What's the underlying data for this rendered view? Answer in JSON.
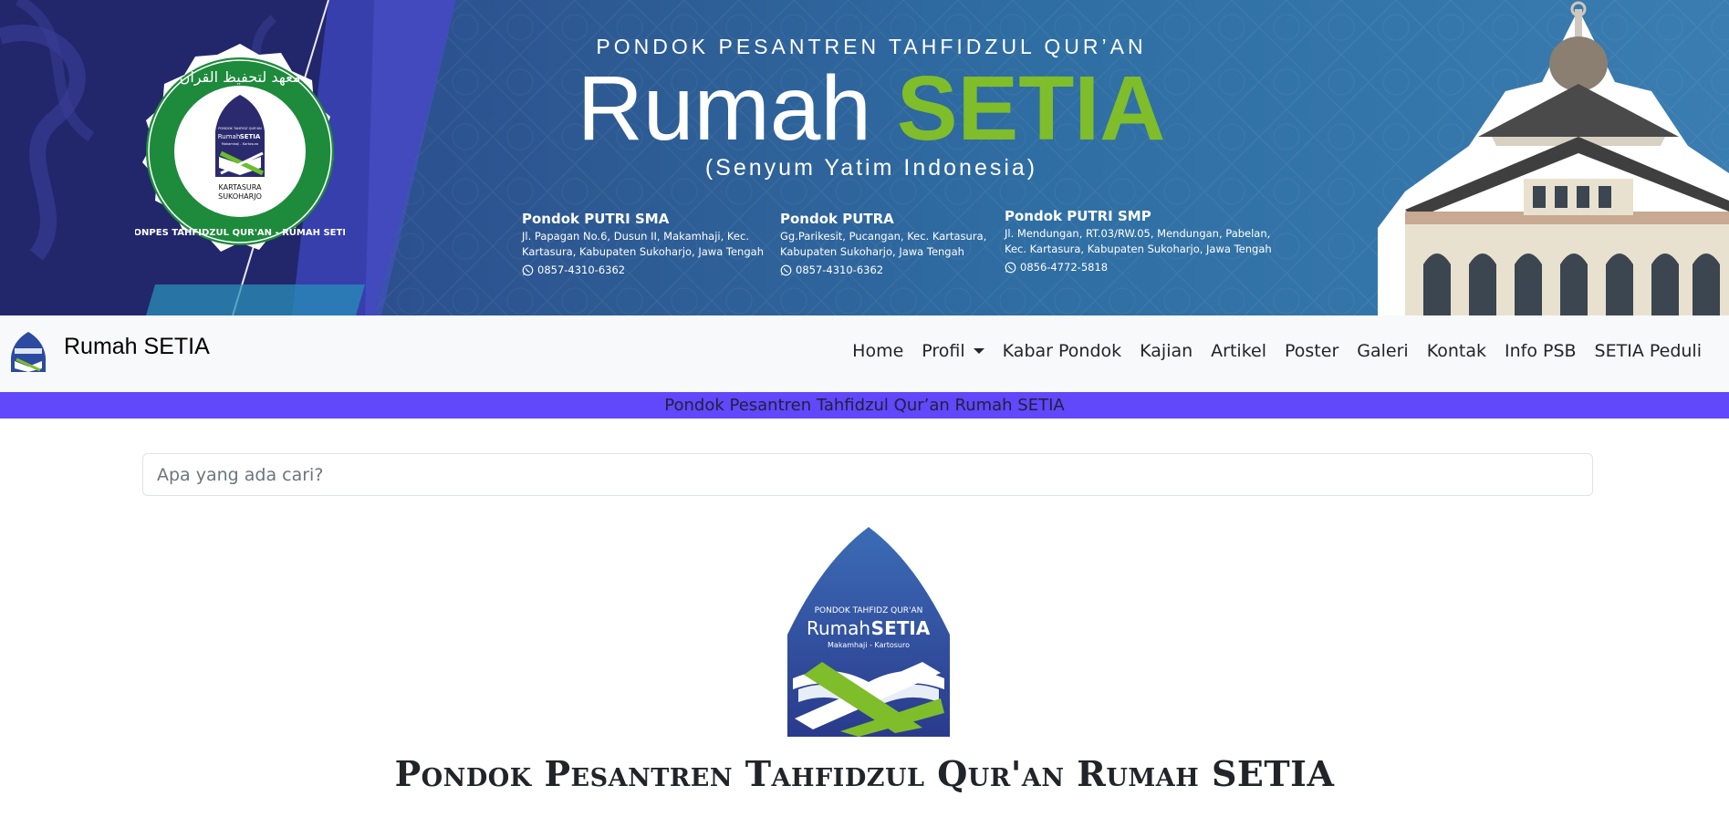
{
  "banner": {
    "kicker": "PONDOK PESANTREN TAHFIDZUL QUR’AN",
    "title_main": "Rumah",
    "title_accent": "SETIA",
    "tagline": "(Senyum Yatim Indonesia)",
    "seal": {
      "arabic": "معهد لتحفيظ القرآن",
      "ring_text": "PONPES TAHFIDZUL QUR'AN - RUMAH SETIA",
      "location_1": "KARTASURA",
      "location_2": "SUKOHARJO",
      "inner_small": "PONDOK TAHFIDZ QUR'AN",
      "inner_brand_1": "Rumah",
      "inner_brand_2": "SETIA",
      "inner_sub": "Makamhaji - Kartosuro"
    },
    "addresses": [
      {
        "name": "Pondok PUTRI SMA",
        "line1": "Jl. Papagan No.6, Dusun II, Makamhaji, Kec.",
        "line2": "Kartasura, Kabupaten Sukoharjo, Jawa Tengah",
        "phone": "0857-4310-6362"
      },
      {
        "name": "Pondok PUTRA",
        "line1": "Gg.Parikesit, Pucangan, Kec. Kartasura,",
        "line2": "Kabupaten Sukoharjo, Jawa Tengah",
        "phone": "0857-4310-6362"
      },
      {
        "name": "Pondok PUTRI SMP",
        "line1": "Jl. Mendungan, RT.03/RW.05, Mendungan, Pabelan,",
        "line2": "Kec. Kartasura, Kabupaten Sukoharjo, Jawa Tengah",
        "phone": "0856-4772-5818"
      }
    ]
  },
  "navbar": {
    "brand": "Rumah SETIA",
    "items": [
      {
        "label": "Home"
      },
      {
        "label": "Profil",
        "dropdown": true
      },
      {
        "label": "Kabar Pondok"
      },
      {
        "label": "Kajian"
      },
      {
        "label": "Artikel"
      },
      {
        "label": "Poster"
      },
      {
        "label": "Galeri"
      },
      {
        "label": "Kontak"
      },
      {
        "label": "Info PSB"
      },
      {
        "label": "SETIA Peduli"
      }
    ]
  },
  "marquee": {
    "text": "Pondok Pesantren Tahfidzul Qur’an Rumah SETIA"
  },
  "search": {
    "placeholder": "Apa yang ada cari?",
    "value": ""
  },
  "main": {
    "logo": {
      "small": "PONDOK TAHFIDZ QUR'AN",
      "brand_1": "Rumah",
      "brand_2": "SETIA",
      "sub": "Makamhaji - Kartosuro"
    },
    "heading": "Pondok Pesantren Tahfidzul Qur'an Rumah SETIA"
  },
  "colors": {
    "accent_green": "#7fbd2a",
    "marquee_bg": "#6148fa",
    "navbar_bg": "#f8f9fa",
    "banner_navy": "#22276b",
    "seal_green": "#1e8a3c"
  }
}
